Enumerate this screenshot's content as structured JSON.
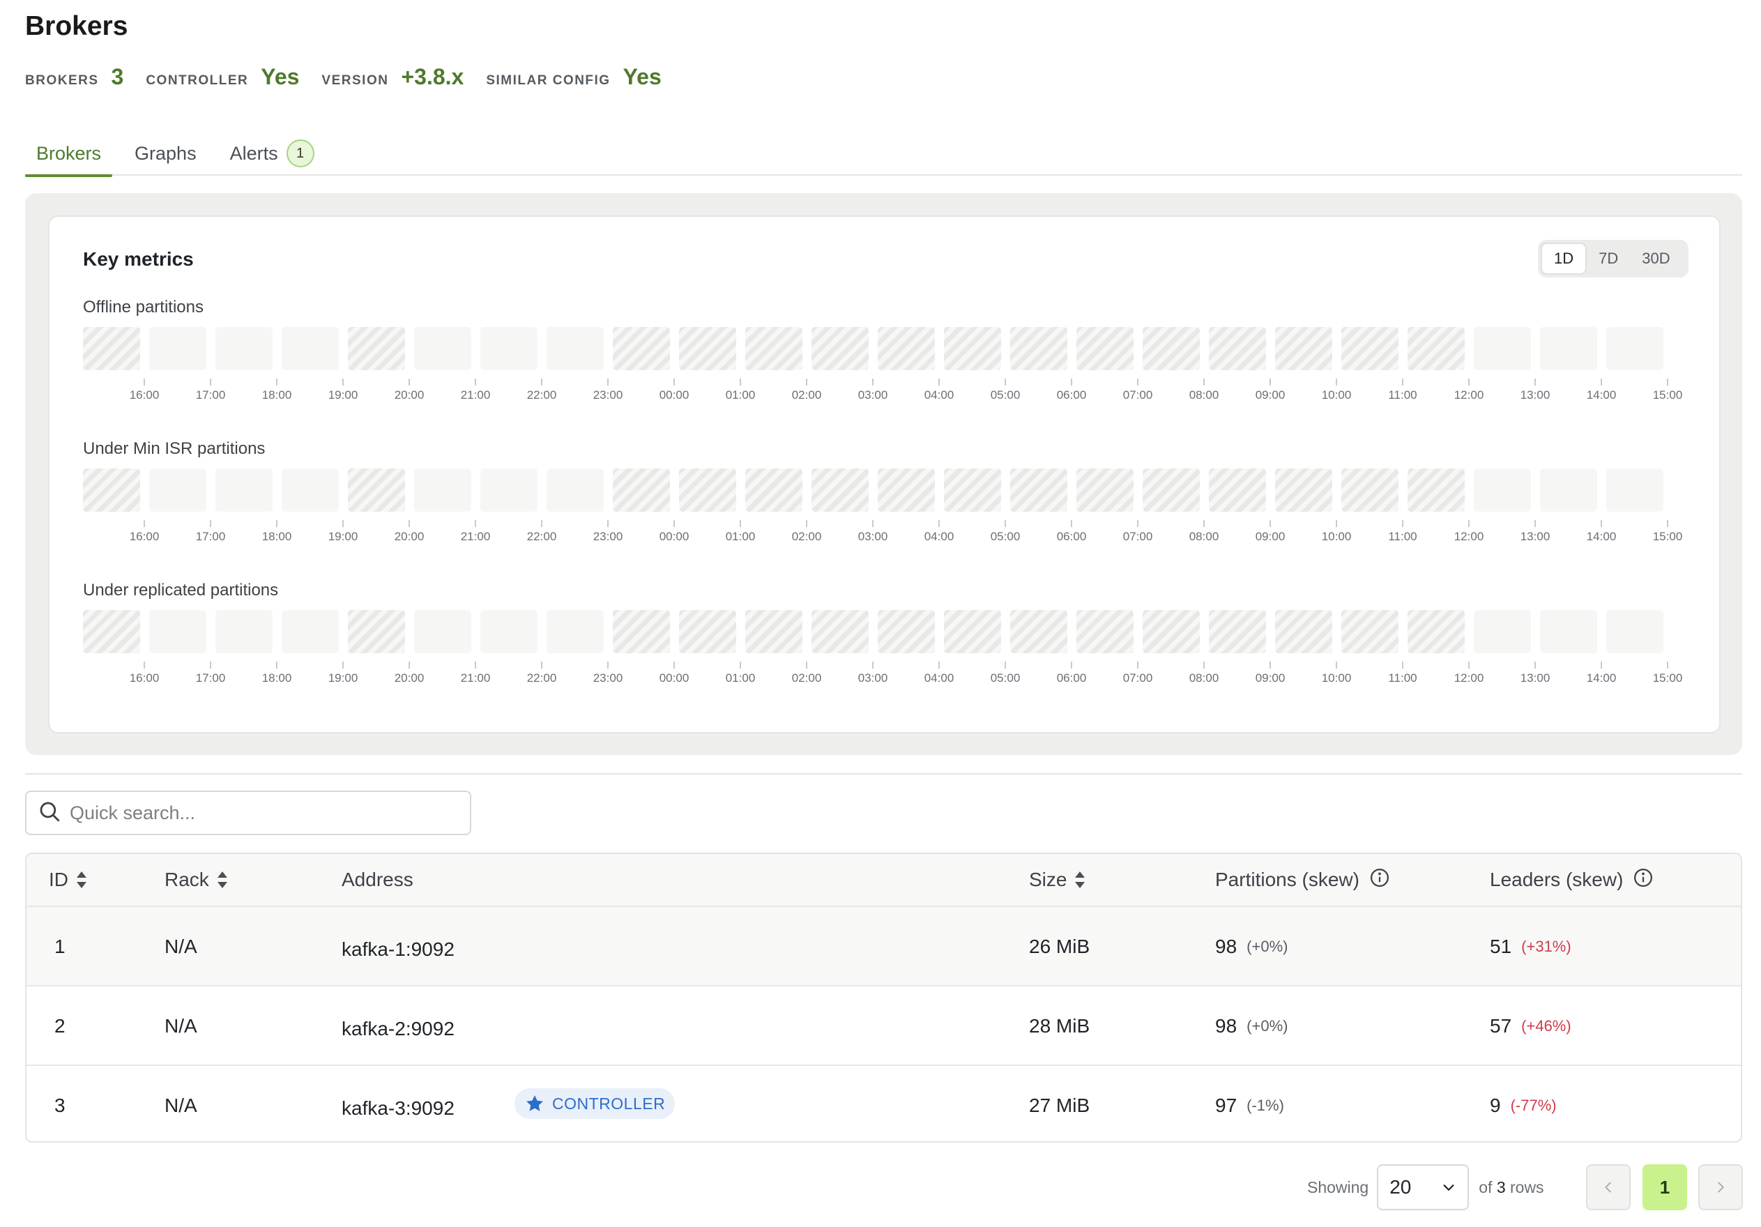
{
  "page": {
    "title": "Brokers"
  },
  "stats": [
    {
      "label": "BROKERS",
      "value": "3"
    },
    {
      "label": "CONTROLLER",
      "value": "Yes"
    },
    {
      "label": "VERSION",
      "value": "+3.8.x"
    },
    {
      "label": "SIMILAR CONFIG",
      "value": "Yes"
    }
  ],
  "tabs": [
    {
      "label": "Brokers",
      "active": true
    },
    {
      "label": "Graphs",
      "active": false
    },
    {
      "label": "Alerts",
      "active": false,
      "badge": "1"
    }
  ],
  "key_metrics": {
    "title": "Key metrics",
    "ranges": [
      "1D",
      "7D",
      "30D"
    ],
    "selected_range": "1D",
    "time_labels": [
      "16:00",
      "17:00",
      "18:00",
      "19:00",
      "20:00",
      "21:00",
      "22:00",
      "23:00",
      "00:00",
      "01:00",
      "02:00",
      "03:00",
      "04:00",
      "05:00",
      "06:00",
      "07:00",
      "08:00",
      "09:00",
      "10:00",
      "11:00",
      "12:00",
      "13:00",
      "14:00",
      "15:00"
    ],
    "charts": [
      {
        "label": "Offline partitions",
        "no_data": [
          true,
          false,
          false,
          false,
          true,
          false,
          false,
          false,
          true,
          true,
          true,
          true,
          true,
          true,
          true,
          true,
          true,
          true,
          true,
          true,
          true,
          false,
          false,
          false
        ]
      },
      {
        "label": "Under Min ISR partitions",
        "no_data": [
          true,
          false,
          false,
          false,
          true,
          false,
          false,
          false,
          true,
          true,
          true,
          true,
          true,
          true,
          true,
          true,
          true,
          true,
          true,
          true,
          true,
          false,
          false,
          false
        ]
      },
      {
        "label": "Under replicated partitions",
        "no_data": [
          true,
          false,
          false,
          false,
          true,
          false,
          false,
          false,
          true,
          true,
          true,
          true,
          true,
          true,
          true,
          true,
          true,
          true,
          true,
          true,
          true,
          false,
          false,
          false
        ]
      }
    ]
  },
  "search": {
    "placeholder": "Quick search..."
  },
  "table": {
    "columns": [
      "ID",
      "Rack",
      "Address",
      "Size",
      "Partitions (skew)",
      "Leaders (skew)"
    ],
    "rows": [
      {
        "id": "1",
        "rack": "N/A",
        "address": "kafka-1:9092",
        "controller": false,
        "size": "26 MiB",
        "partitions": "98",
        "partitions_skew": "(+0%)",
        "leaders": "51",
        "leaders_skew": "(+31%)"
      },
      {
        "id": "2",
        "rack": "N/A",
        "address": "kafka-2:9092",
        "controller": false,
        "size": "28 MiB",
        "partitions": "98",
        "partitions_skew": "(+0%)",
        "leaders": "57",
        "leaders_skew": "(+46%)"
      },
      {
        "id": "3",
        "rack": "N/A",
        "address": "kafka-3:9092",
        "controller": true,
        "size": "27 MiB",
        "partitions": "97",
        "partitions_skew": "(-1%)",
        "leaders": "9",
        "leaders_skew": "(-77%)"
      }
    ],
    "controller_badge": "CONTROLLER"
  },
  "pagination": {
    "showing_label": "Showing",
    "page_size": "20",
    "of_label": "of",
    "total_rows": "3",
    "rows_label": "rows",
    "current_page": "1"
  },
  "colors": {
    "accent": "#4f7a2b",
    "bad": "#d23a4a",
    "badge_bg": "#c9f28d"
  }
}
